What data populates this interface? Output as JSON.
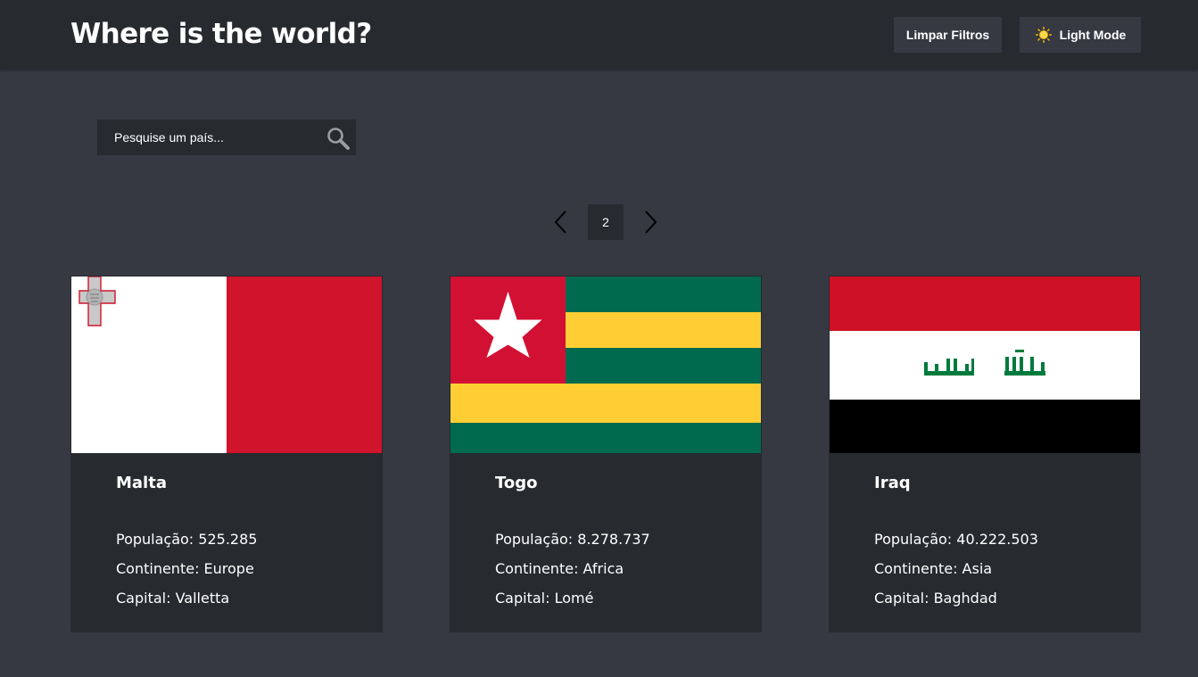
{
  "header": {
    "title": "Where is the world?",
    "clear_filters_label": "Limpar Filtros",
    "theme_toggle_label": "Light Mode",
    "theme_icon": "sun-icon"
  },
  "search": {
    "placeholder": "Pesquise um país...",
    "value": "",
    "icon": "search-icon"
  },
  "pagination": {
    "current_page": "2",
    "prev_icon": "chevron-left-icon",
    "next_icon": "chevron-right-icon"
  },
  "cards": [
    {
      "name": "Malta",
      "population_label": "População: 525.285",
      "continent_label": "Continente: Europe",
      "capital_label": "Capital: Valletta",
      "flag": "malta-flag",
      "flag_colors": [
        "#ffffff",
        "#cf142b",
        "#c0c0c0"
      ]
    },
    {
      "name": "Togo",
      "population_label": "População: 8.278.737",
      "continent_label": "Continente: Africa",
      "capital_label": "Capital: Lomé",
      "flag": "togo-flag",
      "flag_colors": [
        "#006a4e",
        "#ffce34",
        "#d21034",
        "#ffffff"
      ]
    },
    {
      "name": "Iraq",
      "population_label": "População: 40.222.503",
      "continent_label": "Continente: Asia",
      "capital_label": "Capital: Baghdad",
      "flag": "iraq-flag",
      "flag_colors": [
        "#ce1126",
        "#ffffff",
        "#000000",
        "#007a3d"
      ]
    }
  ],
  "colors": {
    "background": "#363942",
    "surface": "#272a2f",
    "text": "#ffffff"
  }
}
